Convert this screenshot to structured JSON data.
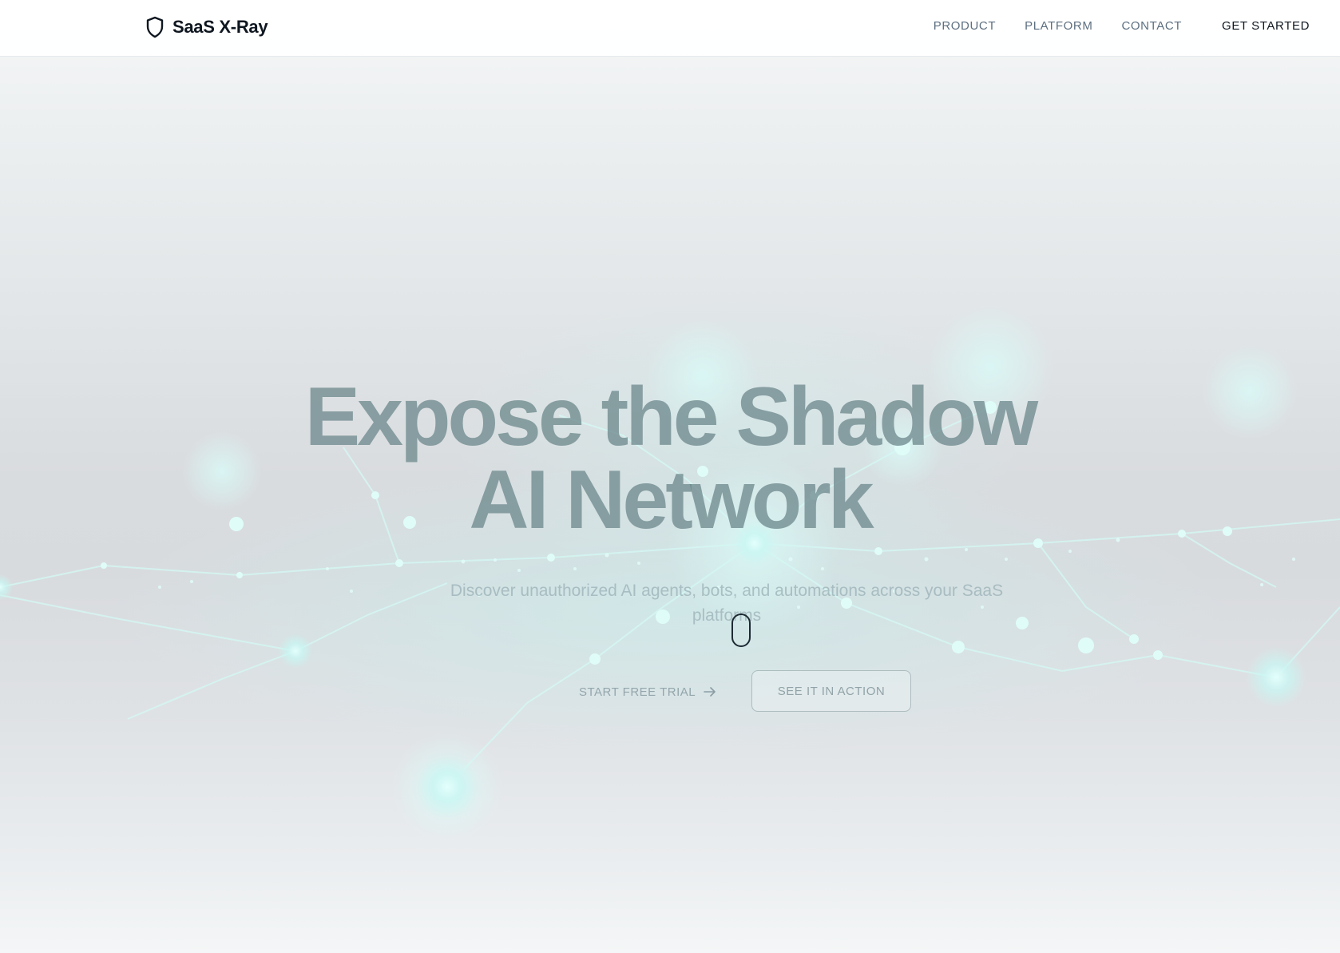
{
  "brand": {
    "name": "SaaS X-Ray",
    "icon": "shield-icon"
  },
  "nav": {
    "links": [
      "PRODUCT",
      "PLATFORM",
      "CONTACT"
    ],
    "cta": "GET STARTED"
  },
  "hero": {
    "title_line1": "Expose the Shadow",
    "title_line2": "AI Network",
    "subtitle_line1": "Discover unauthorized AI agents, bots, and automations across your SaaS",
    "subtitle_line2": "platforms",
    "primary_button": "START FREE TRIAL",
    "primary_button_icon": "arrow-right-icon",
    "secondary_button": "SEE IT IN ACTION"
  },
  "colors": {
    "accent": "#bff5f0",
    "text_dark": "#0f1720",
    "nav_link": "#5d6f80"
  }
}
